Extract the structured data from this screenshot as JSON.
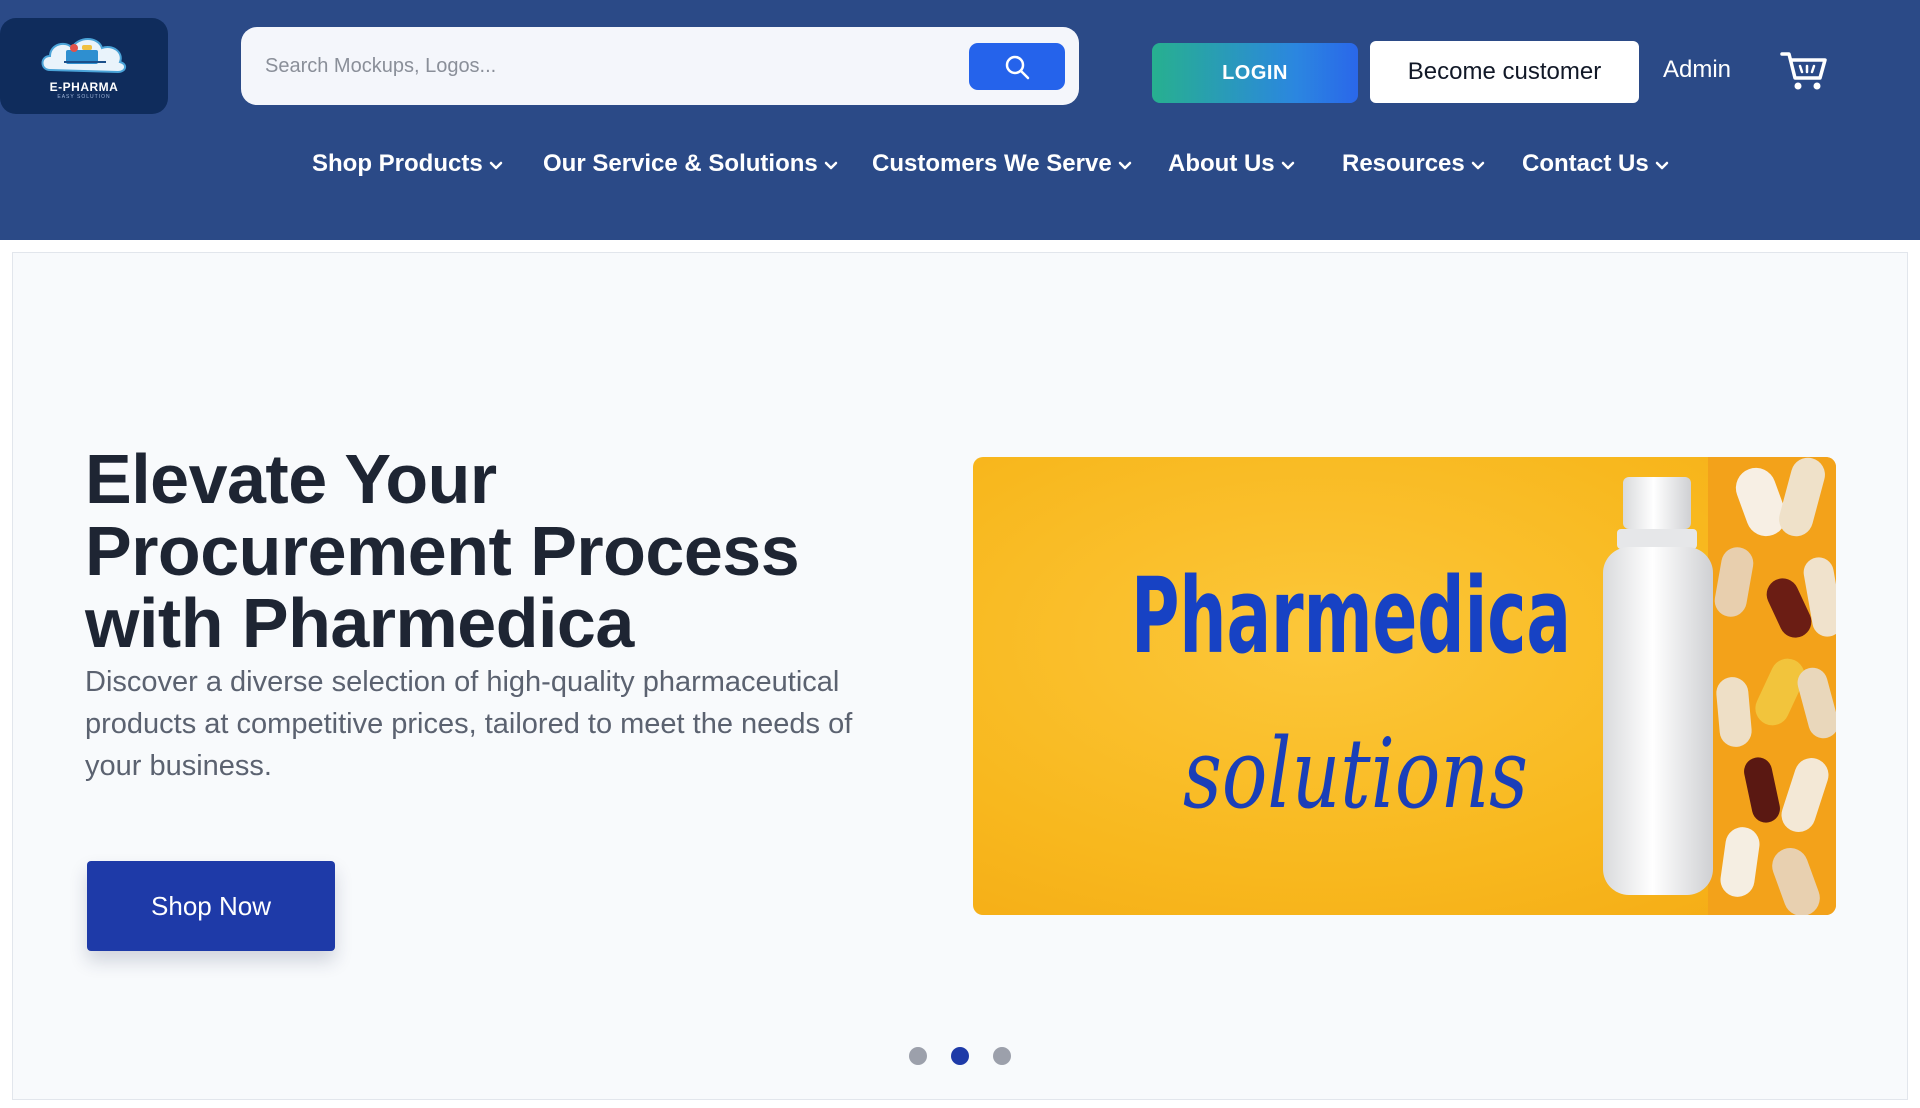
{
  "logo": {
    "name": "E-PHARMA",
    "tagline": "EASY SOLUTION"
  },
  "search": {
    "placeholder": "Search Mockups, Logos..."
  },
  "header": {
    "login_label": "LOGIN",
    "become_customer_label": "Become customer",
    "admin_label": "Admin"
  },
  "nav": {
    "items": [
      {
        "label": "Shop Products"
      },
      {
        "label": "Our Service & Solutions"
      },
      {
        "label": "Customers We Serve"
      },
      {
        "label": "About Us"
      },
      {
        "label": "Resources"
      },
      {
        "label": "Contact Us"
      }
    ]
  },
  "hero": {
    "title_lines": [
      "Elevate Your",
      "Procurement Process",
      "with Pharmedica"
    ],
    "description": "Discover a diverse selection of high-quality pharmaceutical products at competitive prices, tailored to meet the needs of your business.",
    "cta_label": "Shop Now",
    "banner": {
      "title": "Pharmedica",
      "subtitle": "solutions"
    },
    "carousel": {
      "total": 3,
      "active_index": 1
    }
  },
  "colors": {
    "header_bg": "#2b4a87",
    "accent_blue": "#2563eb",
    "cta_blue": "#1e3aa8",
    "banner_yellow": "#f8b81e"
  },
  "icons": [
    "search-icon",
    "cart-icon",
    "chevron-down-icon"
  ]
}
